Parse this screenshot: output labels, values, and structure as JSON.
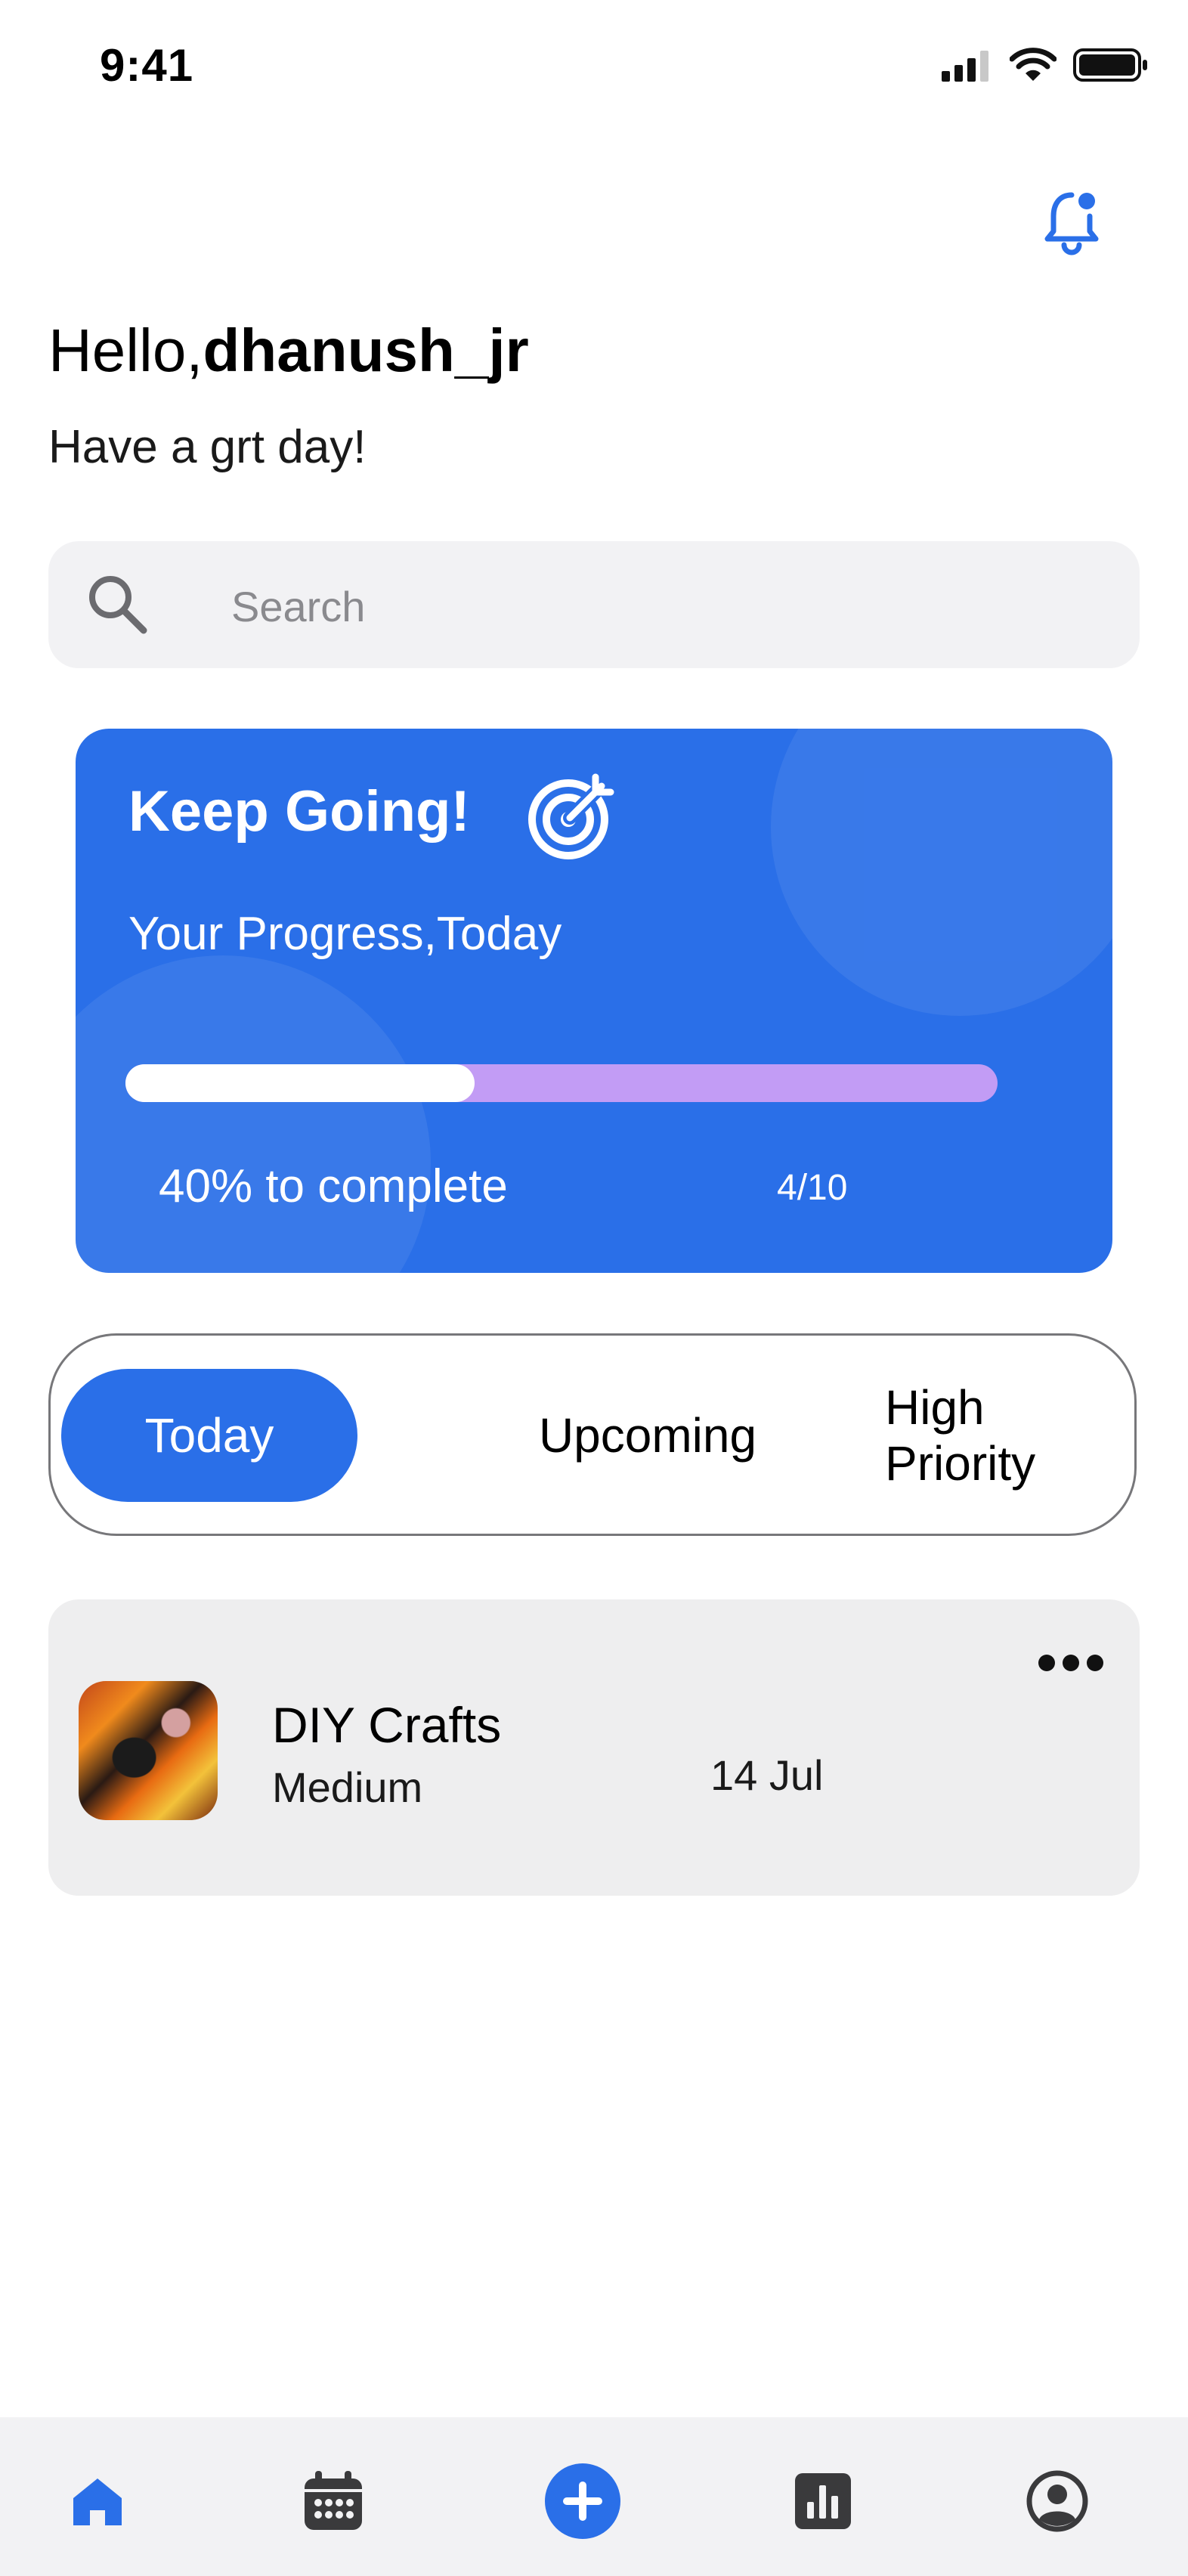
{
  "status_bar": {
    "time": "9:41"
  },
  "greeting": {
    "hello": "Hello,",
    "username": "dhanush_jr",
    "subtitle": "Have a grt day!"
  },
  "search": {
    "placeholder": "Search"
  },
  "progress_card": {
    "title": "Keep Going!",
    "subtitle": "Your Progress,Today",
    "progress_percent": 40,
    "percent_label": "40% to complete",
    "count_label": "4/10",
    "colors": {
      "card": "#2a6fe8",
      "track": "#c29cf5",
      "fill": "#ffffff"
    }
  },
  "tabs": [
    {
      "label": "Today",
      "active": true
    },
    {
      "label": "Upcoming",
      "active": false
    },
    {
      "label": "High Priority",
      "active": false
    }
  ],
  "tasks": [
    {
      "title": "DIY Crafts",
      "priority": "Medium",
      "date": "14 Jul"
    }
  ],
  "bottom_nav": [
    {
      "icon": "home-icon",
      "active": true
    },
    {
      "icon": "calendar-icon",
      "active": false
    },
    {
      "icon": "add-icon",
      "active": false
    },
    {
      "icon": "stats-icon",
      "active": false
    },
    {
      "icon": "profile-icon",
      "active": false
    }
  ],
  "accent_color": "#2a6fe8"
}
